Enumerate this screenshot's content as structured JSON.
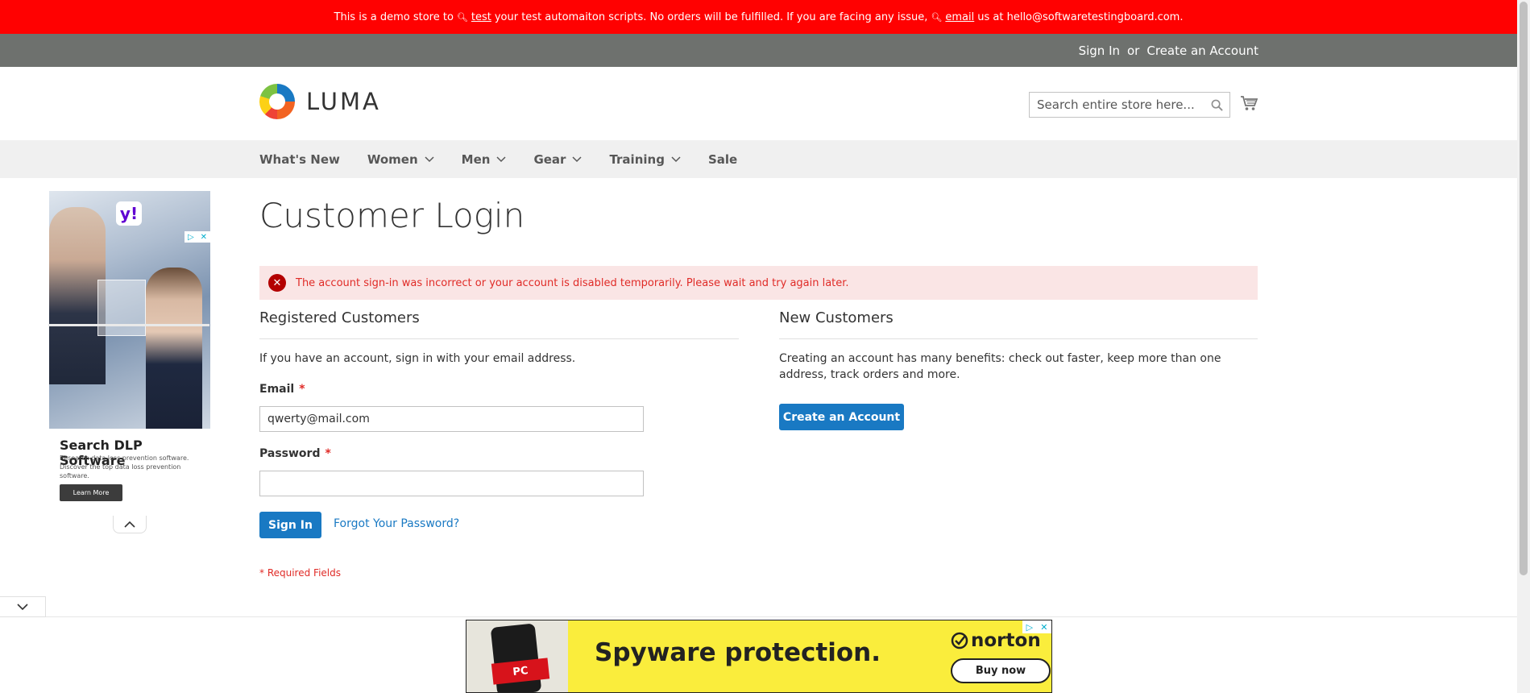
{
  "demo_banner": {
    "part1": "This is a demo store to",
    "link1": "test",
    "part2": "your test automaiton scripts. No orders will be fulfilled. If you are facing any issue,",
    "link2": "email",
    "part3": "us at hello@softwaretestingboard.com."
  },
  "header_links": {
    "sign_in": "Sign In",
    "or": "or",
    "create_account": "Create an Account"
  },
  "logo": {
    "text": "LUMA"
  },
  "search": {
    "placeholder": "Search entire store here..."
  },
  "nav": {
    "items": [
      {
        "label": "What's New"
      },
      {
        "label": "Women"
      },
      {
        "label": "Men"
      },
      {
        "label": "Gear"
      },
      {
        "label": "Training"
      },
      {
        "label": "Sale"
      }
    ]
  },
  "page": {
    "title": "Customer Login"
  },
  "error": {
    "message": "The account sign-in was incorrect or your account is disabled temporarily. Please wait and try again later."
  },
  "registered": {
    "title": "Registered Customers",
    "intro": "If you have an account, sign in with your email address.",
    "email_label": "Email",
    "email_value": "qwerty@mail.com",
    "password_label": "Password",
    "password_value": "",
    "required_star": "*",
    "sign_in_button": "Sign In",
    "forgot_link": "Forgot Your Password?",
    "required_note": "* Required Fields"
  },
  "new_customers": {
    "title": "New Customers",
    "text": "Creating an account has many benefits: check out faster, keep more than one address, track orders and more.",
    "button": "Create an Account"
  },
  "ad_left": {
    "badge": "y!",
    "title": "Search DLP Software",
    "line1": "Research data loss prevention software.",
    "line2": "Discover the top data loss prevention software.",
    "button": "Learn More"
  },
  "ad_bottom": {
    "badge": "PC",
    "headline": "Spyware protection.",
    "brand": "norton",
    "button": "Buy now"
  },
  "colors": {
    "banner": "#ff0101",
    "panel": "#6e716e",
    "primary": "#1979c3",
    "error_bg": "#fae5e5",
    "error_text": "#e02b27"
  }
}
